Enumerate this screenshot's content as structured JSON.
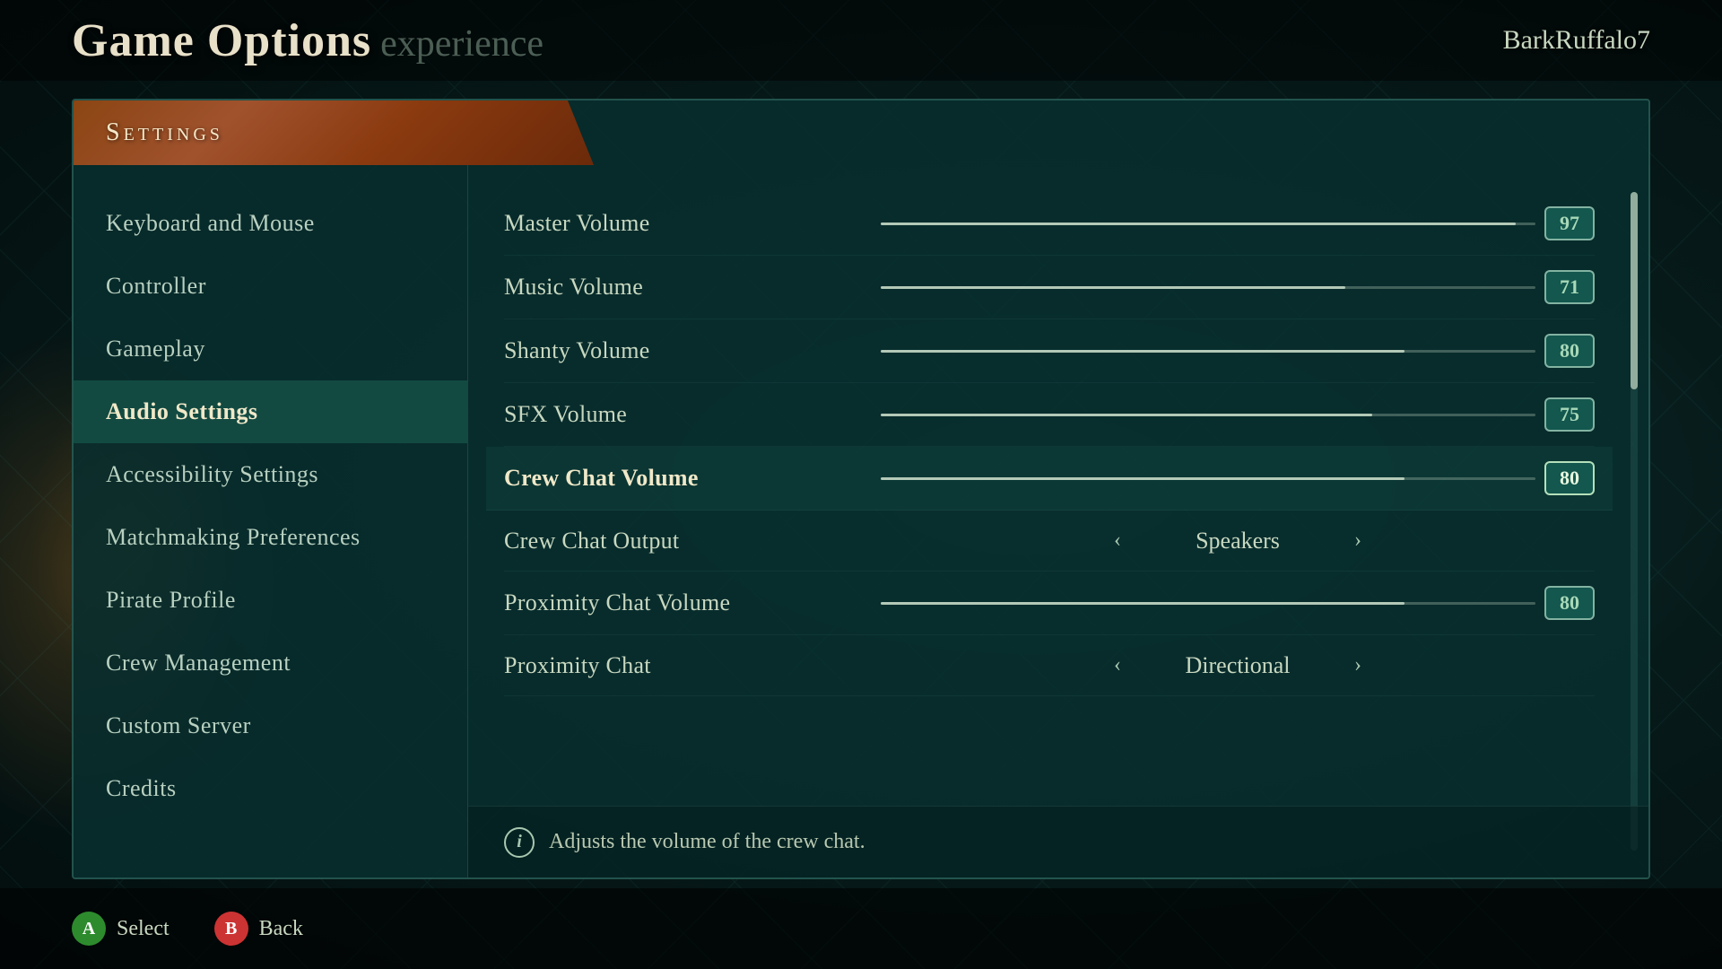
{
  "header": {
    "game_title": "Game Options",
    "game_subtitle": "experience",
    "username": "BarkRuffalo7"
  },
  "settings_panel": {
    "banner_text": "Settings"
  },
  "nav": {
    "items": [
      {
        "id": "keyboard-mouse",
        "label": "Keyboard and Mouse",
        "active": false
      },
      {
        "id": "controller",
        "label": "Controller",
        "active": false
      },
      {
        "id": "gameplay",
        "label": "Gameplay",
        "active": false
      },
      {
        "id": "audio-settings",
        "label": "Audio Settings",
        "active": true
      },
      {
        "id": "accessibility",
        "label": "Accessibility Settings",
        "active": false
      },
      {
        "id": "matchmaking",
        "label": "Matchmaking Preferences",
        "active": false
      },
      {
        "id": "pirate-profile",
        "label": "Pirate Profile",
        "active": false
      },
      {
        "id": "crew-management",
        "label": "Crew Management",
        "active": false
      },
      {
        "id": "custom-server",
        "label": "Custom Server",
        "active": false
      },
      {
        "id": "credits",
        "label": "Credits",
        "active": false
      }
    ]
  },
  "audio_settings": {
    "sliders": [
      {
        "id": "master-volume",
        "label": "Master Volume",
        "value": 97,
        "percent": 97,
        "highlighted": false
      },
      {
        "id": "music-volume",
        "label": "Music Volume",
        "value": 71,
        "percent": 71,
        "highlighted": false
      },
      {
        "id": "shanty-volume",
        "label": "Shanty Volume",
        "value": 80,
        "percent": 80,
        "highlighted": false
      },
      {
        "id": "sfx-volume",
        "label": "SFX Volume",
        "value": 75,
        "percent": 75,
        "highlighted": false
      },
      {
        "id": "crew-chat-volume",
        "label": "Crew Chat Volume",
        "value": 80,
        "percent": 80,
        "highlighted": true
      },
      {
        "id": "proximity-chat-volume",
        "label": "Proximity Chat Volume",
        "value": 80,
        "percent": 80,
        "highlighted": false
      }
    ],
    "selectors": [
      {
        "id": "crew-chat-output",
        "label": "Crew Chat Output",
        "value": "Speakers"
      },
      {
        "id": "proximity-chat",
        "label": "Proximity Chat",
        "value": "Directional"
      }
    ],
    "info_text": "Adjusts the volume of the crew chat."
  },
  "bottom_hints": [
    {
      "id": "select",
      "button": "A",
      "label": "Select",
      "color": "#2d8b2d"
    },
    {
      "id": "back",
      "button": "B",
      "label": "Back",
      "color": "#cc3333"
    }
  ]
}
